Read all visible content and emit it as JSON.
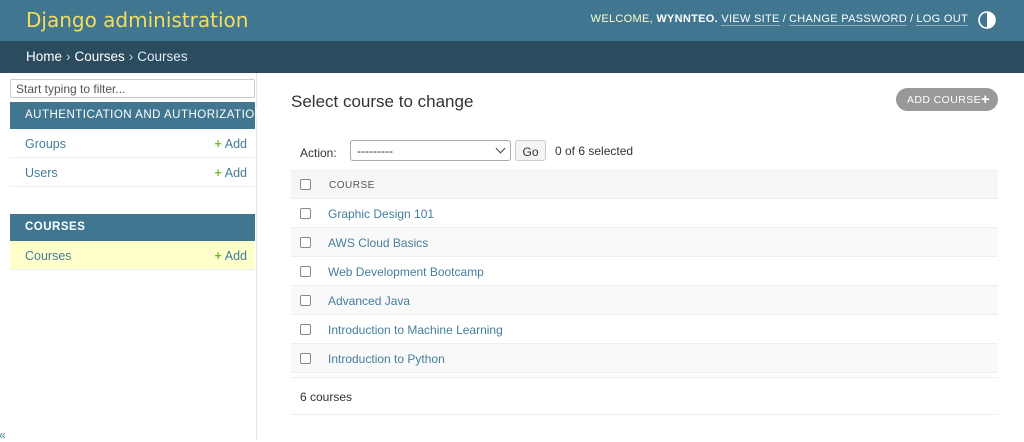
{
  "header": {
    "branding": "Django administration",
    "welcome": "Welcome,",
    "username": "wynnteo.",
    "view_site": "View site",
    "change_password": "Change password",
    "log_out": "Log out",
    "separator": "/",
    "theme_icon": "contrast-toggle-icon"
  },
  "breadcrumbs": {
    "home": "Home",
    "app": "Courses",
    "current": "Courses",
    "separator": "›"
  },
  "sidebar": {
    "filter_placeholder": "Start typing to filter...",
    "apps": [
      {
        "name": "Authentication and Authorization",
        "models": [
          {
            "name": "Groups",
            "add": "Add"
          },
          {
            "name": "Users",
            "add": "Add"
          }
        ]
      },
      {
        "name": "Courses",
        "models": [
          {
            "name": "Courses",
            "add": "Add"
          }
        ]
      }
    ],
    "collapse_glyph": "«",
    "add_plus": "+"
  },
  "content": {
    "title": "Select course to change",
    "add_button": "Add course",
    "add_plus": "+",
    "action_label": "Action:",
    "action_selected": "---------",
    "go_label": "Go",
    "selection_counter": "0 of 6 selected",
    "column_header": "Course",
    "rows": [
      "Graphic Design 101",
      "AWS Cloud Basics",
      "Web Development Bootcamp",
      "Advanced Java",
      "Introduction to Machine Learning",
      "Introduction to Python"
    ],
    "paginator": "6 courses"
  },
  "colors": {
    "header_bg": "#417690",
    "breadcrumb_bg": "#2b4c5f",
    "branding": "#f5dd5d",
    "link": "#447e9b",
    "add_green": "#70bf2b",
    "current_row": "#ffffcc"
  }
}
